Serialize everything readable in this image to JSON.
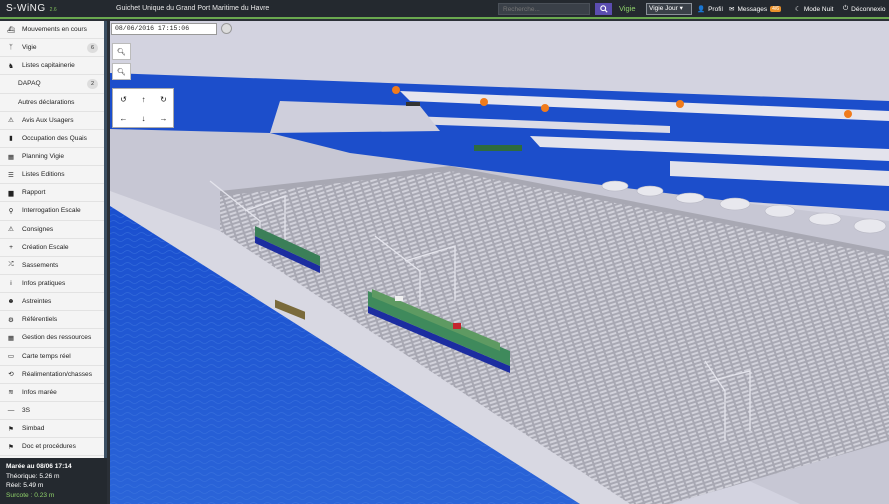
{
  "app": {
    "name": "S-WiNG",
    "version": "2.6",
    "title": "Guichet Unique du Grand Port Maritime du Havre"
  },
  "topbar": {
    "search_placeholder": "Recherche...",
    "vigie_label": "Vigie",
    "vigie_select": "Vigie Jour",
    "profil": "Profil",
    "messages": "Messages",
    "messages_badge": "4/6",
    "mode_nuit": "Mode Nuit",
    "deconnexion": "Déconnexio"
  },
  "sidebar": {
    "items": [
      {
        "label": "Mouvements en cours",
        "icon": "ship-icon"
      },
      {
        "label": "Vigie",
        "icon": "antenna-icon",
        "count": "6"
      },
      {
        "label": "Listes capitainerie",
        "icon": "captain-icon"
      },
      {
        "label": "DAPAQ",
        "icon": "",
        "count": "2"
      },
      {
        "label": "Autres déclarations",
        "icon": ""
      },
      {
        "label": "Avis Aux Usagers",
        "icon": "warning-icon"
      },
      {
        "label": "Occupation des Quais",
        "icon": "chart-icon"
      },
      {
        "label": "Planning Vigie",
        "icon": "calendar-icon"
      },
      {
        "label": "Listes Editions",
        "icon": "list-icon"
      },
      {
        "label": "Rapport",
        "icon": "book-icon"
      },
      {
        "label": "Interrogation Escale",
        "icon": "search-icon"
      },
      {
        "label": "Consignes",
        "icon": "warning-icon"
      },
      {
        "label": "Création Escale",
        "icon": "plus-icon"
      },
      {
        "label": "Sassements",
        "icon": "shuffle-icon"
      },
      {
        "label": "Infos pratiques",
        "icon": "info-icon"
      },
      {
        "label": "Astreintes",
        "icon": "user-icon"
      },
      {
        "label": "Référentiels",
        "icon": "gears-icon"
      },
      {
        "label": "Gestion des ressources",
        "icon": "grid-icon"
      },
      {
        "label": "Carte temps réel",
        "icon": "map-icon"
      },
      {
        "label": "Réalimentation/chasses",
        "icon": "refresh-icon"
      },
      {
        "label": "Infos marée",
        "icon": "wave-icon"
      },
      {
        "label": "3S",
        "icon": "minus-icon"
      },
      {
        "label": "Simbad",
        "icon": "flag-icon"
      },
      {
        "label": "Doc et procédures",
        "icon": "flag-icon"
      }
    ]
  },
  "tide": {
    "title": "Marée au 08/06 17:14",
    "theorique": "Théorique: 5.26 m",
    "reel": "Réel: 5.49 m",
    "surcote": "Surcote : 0.23 m"
  },
  "viewer": {
    "datetime": "08/06/2016 17:15:06",
    "colors": {
      "sea": "#1f4fc9",
      "land": "#c9c9d6",
      "terminal": "#a9a9b2",
      "sky": "#d8d8e4"
    }
  }
}
